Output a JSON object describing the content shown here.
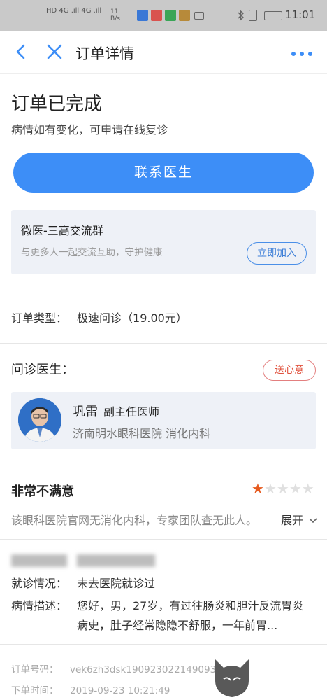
{
  "status_bar": {
    "net_labels": "HD 4G .ıll 4G .ıll",
    "speed": "11 B/s",
    "time": "11:01"
  },
  "nav": {
    "title": "订单详情"
  },
  "order_status": {
    "title": "订单已完成",
    "subtitle": "病情如有变化，可申请在线复诊",
    "contact_button": "联系医生"
  },
  "group": {
    "name": "微医-三高交流群",
    "description": "与更多人一起交流互助，守护健康",
    "join_button": "立即加入"
  },
  "order_type": {
    "label": "订单类型：",
    "value": "极速问诊（19.00元）"
  },
  "doctor_section": {
    "label": "问诊医生：",
    "gift_button": "送心意",
    "doctor_name": "巩雷",
    "doctor_title": "副主任医师",
    "hospital_dept": "济南明水眼科医院  消化内科"
  },
  "rating": {
    "label": "非常不满意",
    "stars": 1,
    "stars_max": 5,
    "review": "该眼科医院官网无消化内科，专家团队查无此人。",
    "expand": "展开"
  },
  "visit": {
    "label": "就诊情况：",
    "value": "未去医院就诊过"
  },
  "description": {
    "label": "病情描述：",
    "value": "您好，男，27岁，有过往肠炎和胆汁反流胃炎病史，肚子经常隐隐不舒服，一年前胃..."
  },
  "footer": {
    "order_no_label": "订单号码：",
    "order_no": "vek6zh3dsk190923022149093",
    "order_time_label": "下单时间：",
    "order_time": "2019-09-23 10:21:49"
  },
  "watermark": {
    "cn": "黑猫",
    "en": "BLACK CAT"
  },
  "colors": {
    "accent": "#3d8ef7",
    "star": "#e65a1e",
    "gift": "#e0523e"
  }
}
